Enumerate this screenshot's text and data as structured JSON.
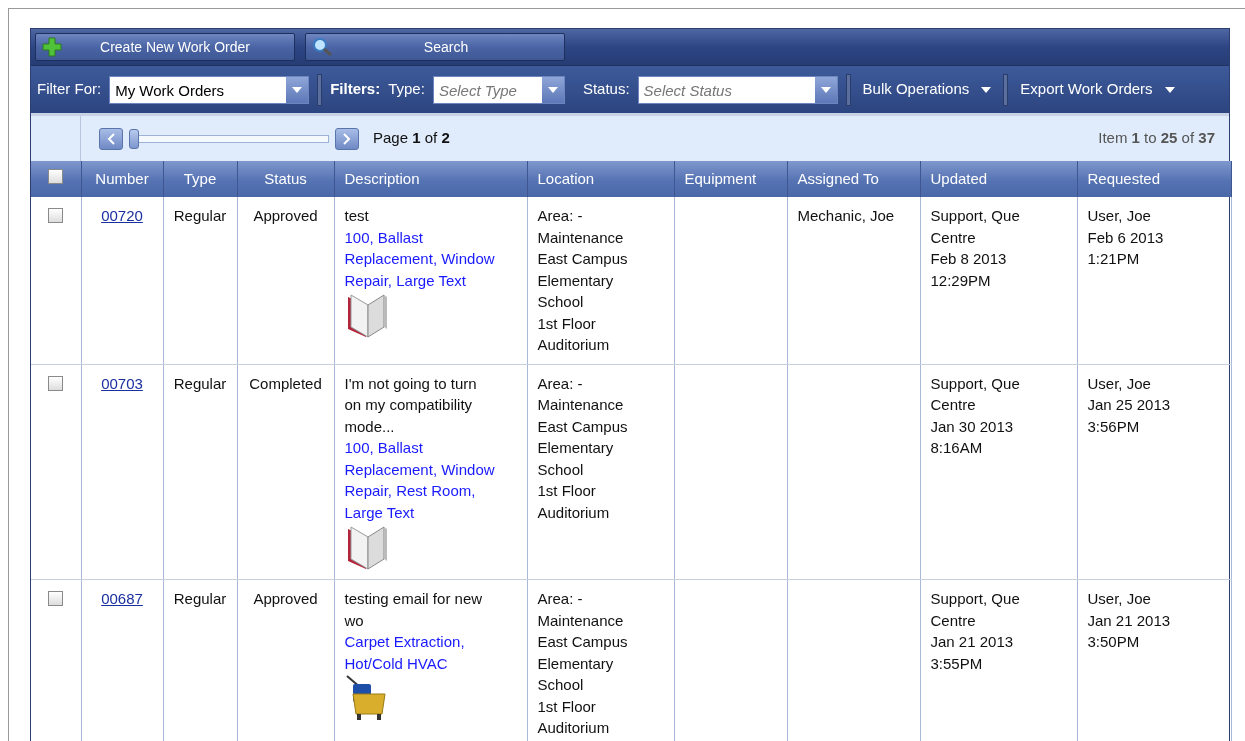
{
  "toolbar": {
    "buttons": [
      {
        "label": "Create New Work Order",
        "kind": "create"
      },
      {
        "label": "Search",
        "kind": "search"
      }
    ]
  },
  "filter_bar": {
    "filter_for_label": "Filter For:",
    "filter_for_value": "My Work Orders",
    "filters_label": "Filters:",
    "type_label": "Type:",
    "type_placeholder": "Select Type",
    "status_label": "Status:",
    "status_placeholder": "Select Status",
    "menus": [
      "Bulk Operations",
      "Export Work Orders"
    ]
  },
  "pager": {
    "level": 0.0,
    "page_text": "Page **1** of **2**",
    "items_text": "Item **1** to **25** of **37**"
  },
  "table": {
    "select_all_checked": false,
    "columns": [
      "Number",
      "Type",
      "Status",
      "Description",
      "Location",
      "Equipment",
      "Assigned To",
      "Updated",
      "Requested"
    ],
    "rows": [
      {
        "checked": false,
        "number": "00720",
        "type": "Regular",
        "status": "Approved",
        "description": "test",
        "categories": "100, Ballast Replacement, Window Repair, Large Text",
        "kind": "book",
        "location": [
          "Area: -",
          "Maintenance",
          "East Campus",
          "Elementary",
          "School",
          "1st Floor",
          "Auditorium"
        ],
        "assigned_to": "Mechanic, Joe",
        "updated": [
          "Support, Que",
          "Centre",
          "Feb 8 2013",
          "12:29PM"
        ],
        "requested": [
          "User, Joe",
          "Feb 6 2013",
          "1:21PM"
        ]
      },
      {
        "checked": false,
        "number": "00703",
        "type": "Regular",
        "status": "Completed",
        "description": "I'm not going to turn on my compatibility mode...",
        "categories": "100, Ballast Replacement, Window Repair, Rest Room, Large Text",
        "kind": "book",
        "location": [
          "Area: -",
          "Maintenance",
          "East Campus",
          "Elementary",
          "School",
          "1st Floor",
          "Auditorium"
        ],
        "updated": [
          "Support, Que",
          "Centre",
          "Jan 30 2013",
          "8:16AM"
        ],
        "requested": [
          "User, Joe",
          "Jan 25 2013",
          "3:56PM"
        ]
      },
      {
        "checked": false,
        "number": "00687",
        "type": "Regular",
        "status": "Approved",
        "description": "testing email for new wo",
        "categories": "Carpet Extraction, Hot/Cold HVAC",
        "kind": "mop-bucket",
        "location": [
          "Area: -",
          "Maintenance",
          "East Campus",
          "Elementary",
          "School",
          "1st Floor",
          "Auditorium"
        ],
        "updated": [
          "Support, Que",
          "Centre",
          "Jan 21 2013",
          "3:55PM"
        ],
        "requested": [
          "User, Joe",
          "Jan 21 2013",
          "3:50PM"
        ]
      }
    ]
  }
}
